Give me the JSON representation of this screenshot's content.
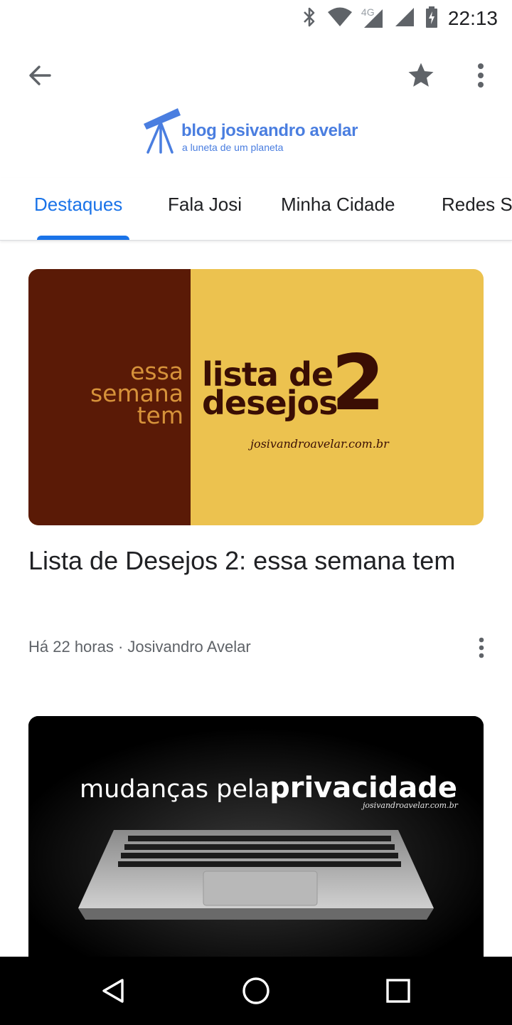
{
  "status_bar": {
    "time": "22:13",
    "network": "4G",
    "icons": [
      "bluetooth-icon",
      "wifi-icon",
      "signal-icon",
      "signal-icon",
      "battery-charging-icon"
    ]
  },
  "app_bar": {
    "back_icon": "arrow-back-icon",
    "star_icon": "star-icon",
    "menu_icon": "more-vert-icon"
  },
  "logo": {
    "title": "blog josivandro avelar",
    "subtitle": "a luneta de um planeta",
    "icon": "telescope-icon",
    "color": "#4a7ee0"
  },
  "tabs": [
    {
      "label": "Destaques",
      "active": true
    },
    {
      "label": "Fala Josi",
      "active": false
    },
    {
      "label": "Minha Cidade",
      "active": false
    },
    {
      "label": "Redes S",
      "active": false
    }
  ],
  "articles": [
    {
      "image": {
        "left_text": [
          "essa",
          "semana",
          "tem"
        ],
        "title_lines": [
          "lista de",
          "desejos"
        ],
        "number": "2",
        "url": "josivandroavelar.com.br"
      },
      "title": "Lista de Desejos 2: essa semana tem",
      "meta": "Há 22 horas · Josivandro Avelar"
    },
    {
      "image": {
        "headline_light": "mudanças pela",
        "headline_bold": "privacidade",
        "url": "josivandroavelar.com.br"
      }
    }
  ],
  "colors": {
    "accent": "#1a73e8",
    "image1_left": "#5a1a06",
    "image1_right": "#ecc24f"
  },
  "nav_bar": {
    "icons": [
      "back-triangle-icon",
      "home-circle-icon",
      "recents-square-icon"
    ]
  }
}
